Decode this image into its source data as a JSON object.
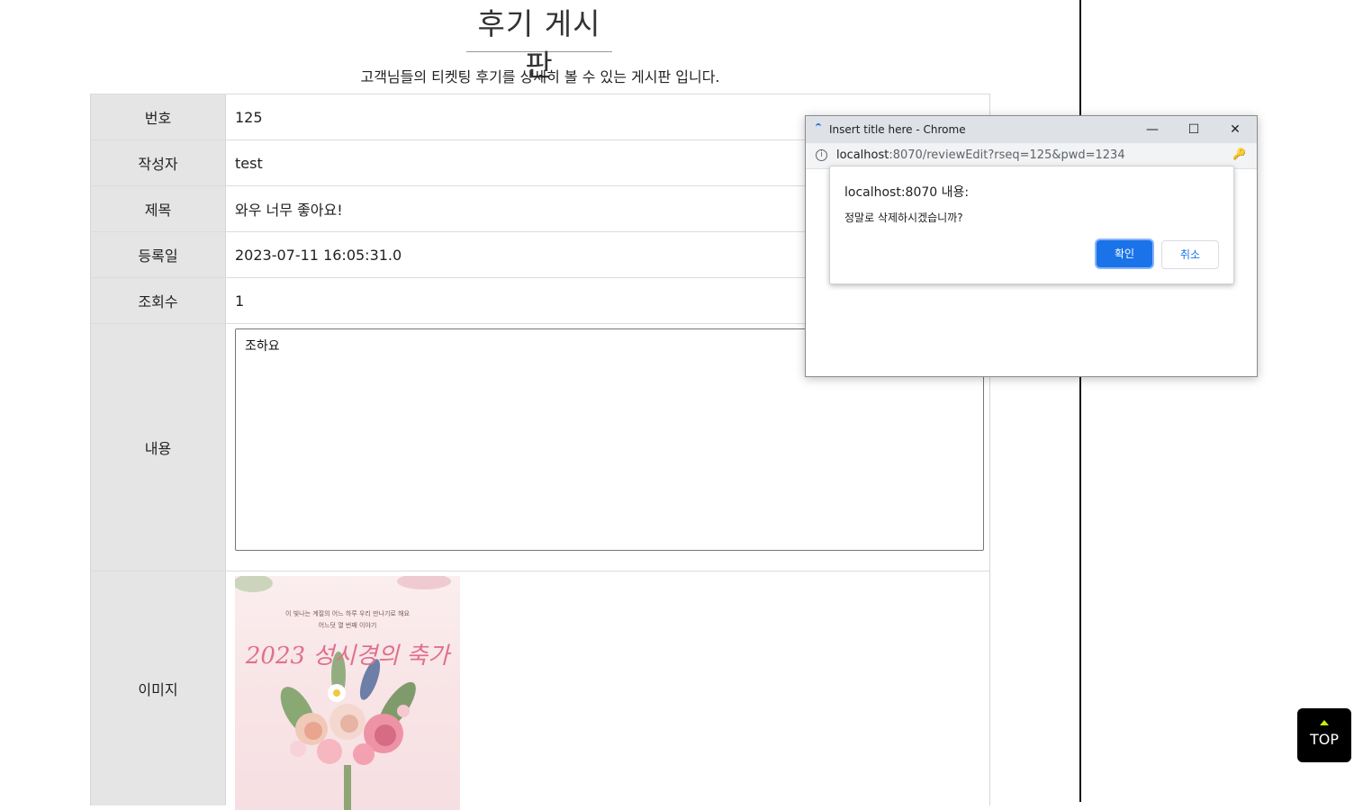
{
  "page": {
    "title": "후기 게시판",
    "subtitle": "고객님들의 티켓팅 후기를 상세히 볼 수 있는 게시판 입니다."
  },
  "board": {
    "labels": {
      "number": "번호",
      "writer": "작성자",
      "subject": "제목",
      "date": "등록일",
      "views": "조회수",
      "content": "내용",
      "image": "이미지"
    },
    "values": {
      "number": "125",
      "writer": "test",
      "subject": "와우 너무 좋아요!",
      "date": "2023-07-11 16:05:31.0",
      "views": "1",
      "content": "조하요"
    },
    "poster": {
      "line1": "이 빛나는 계절의 어느 하루 우리 만나기로 해요",
      "line2": "어느덧 열 번째 이야기",
      "title": "2023 성시경의 축가"
    }
  },
  "top_button": {
    "label": "TOP"
  },
  "popup": {
    "window_title": "Insert title here - Chrome",
    "url_host": "localhost",
    "url_path": ":8070/reviewEdit?rseq=125&pwd=1234",
    "dialog": {
      "title": "localhost:8070 내용:",
      "message": "정말로 삭제하시겠습니까?",
      "ok_label": "확인",
      "cancel_label": "취소"
    }
  }
}
